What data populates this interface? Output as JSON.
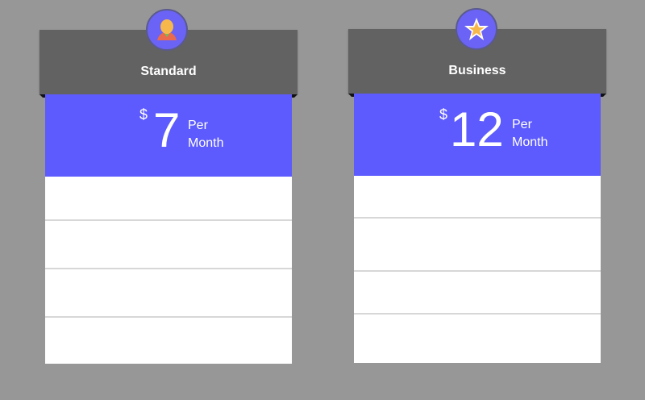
{
  "colors": {
    "background": "#979797",
    "header": "#626262",
    "accent": "#5d5bfd",
    "white": "#ffffff",
    "divider": "#d7d7d7"
  },
  "plans": [
    {
      "name": "Standard",
      "icon": "user-avatar-icon",
      "currency": "$",
      "price": "7",
      "period_line1": "Per",
      "period_line2": "Month"
    },
    {
      "name": "Business",
      "icon": "star-icon",
      "currency": "$",
      "price": "12",
      "period_line1": "Per",
      "period_line2": "Month"
    }
  ]
}
